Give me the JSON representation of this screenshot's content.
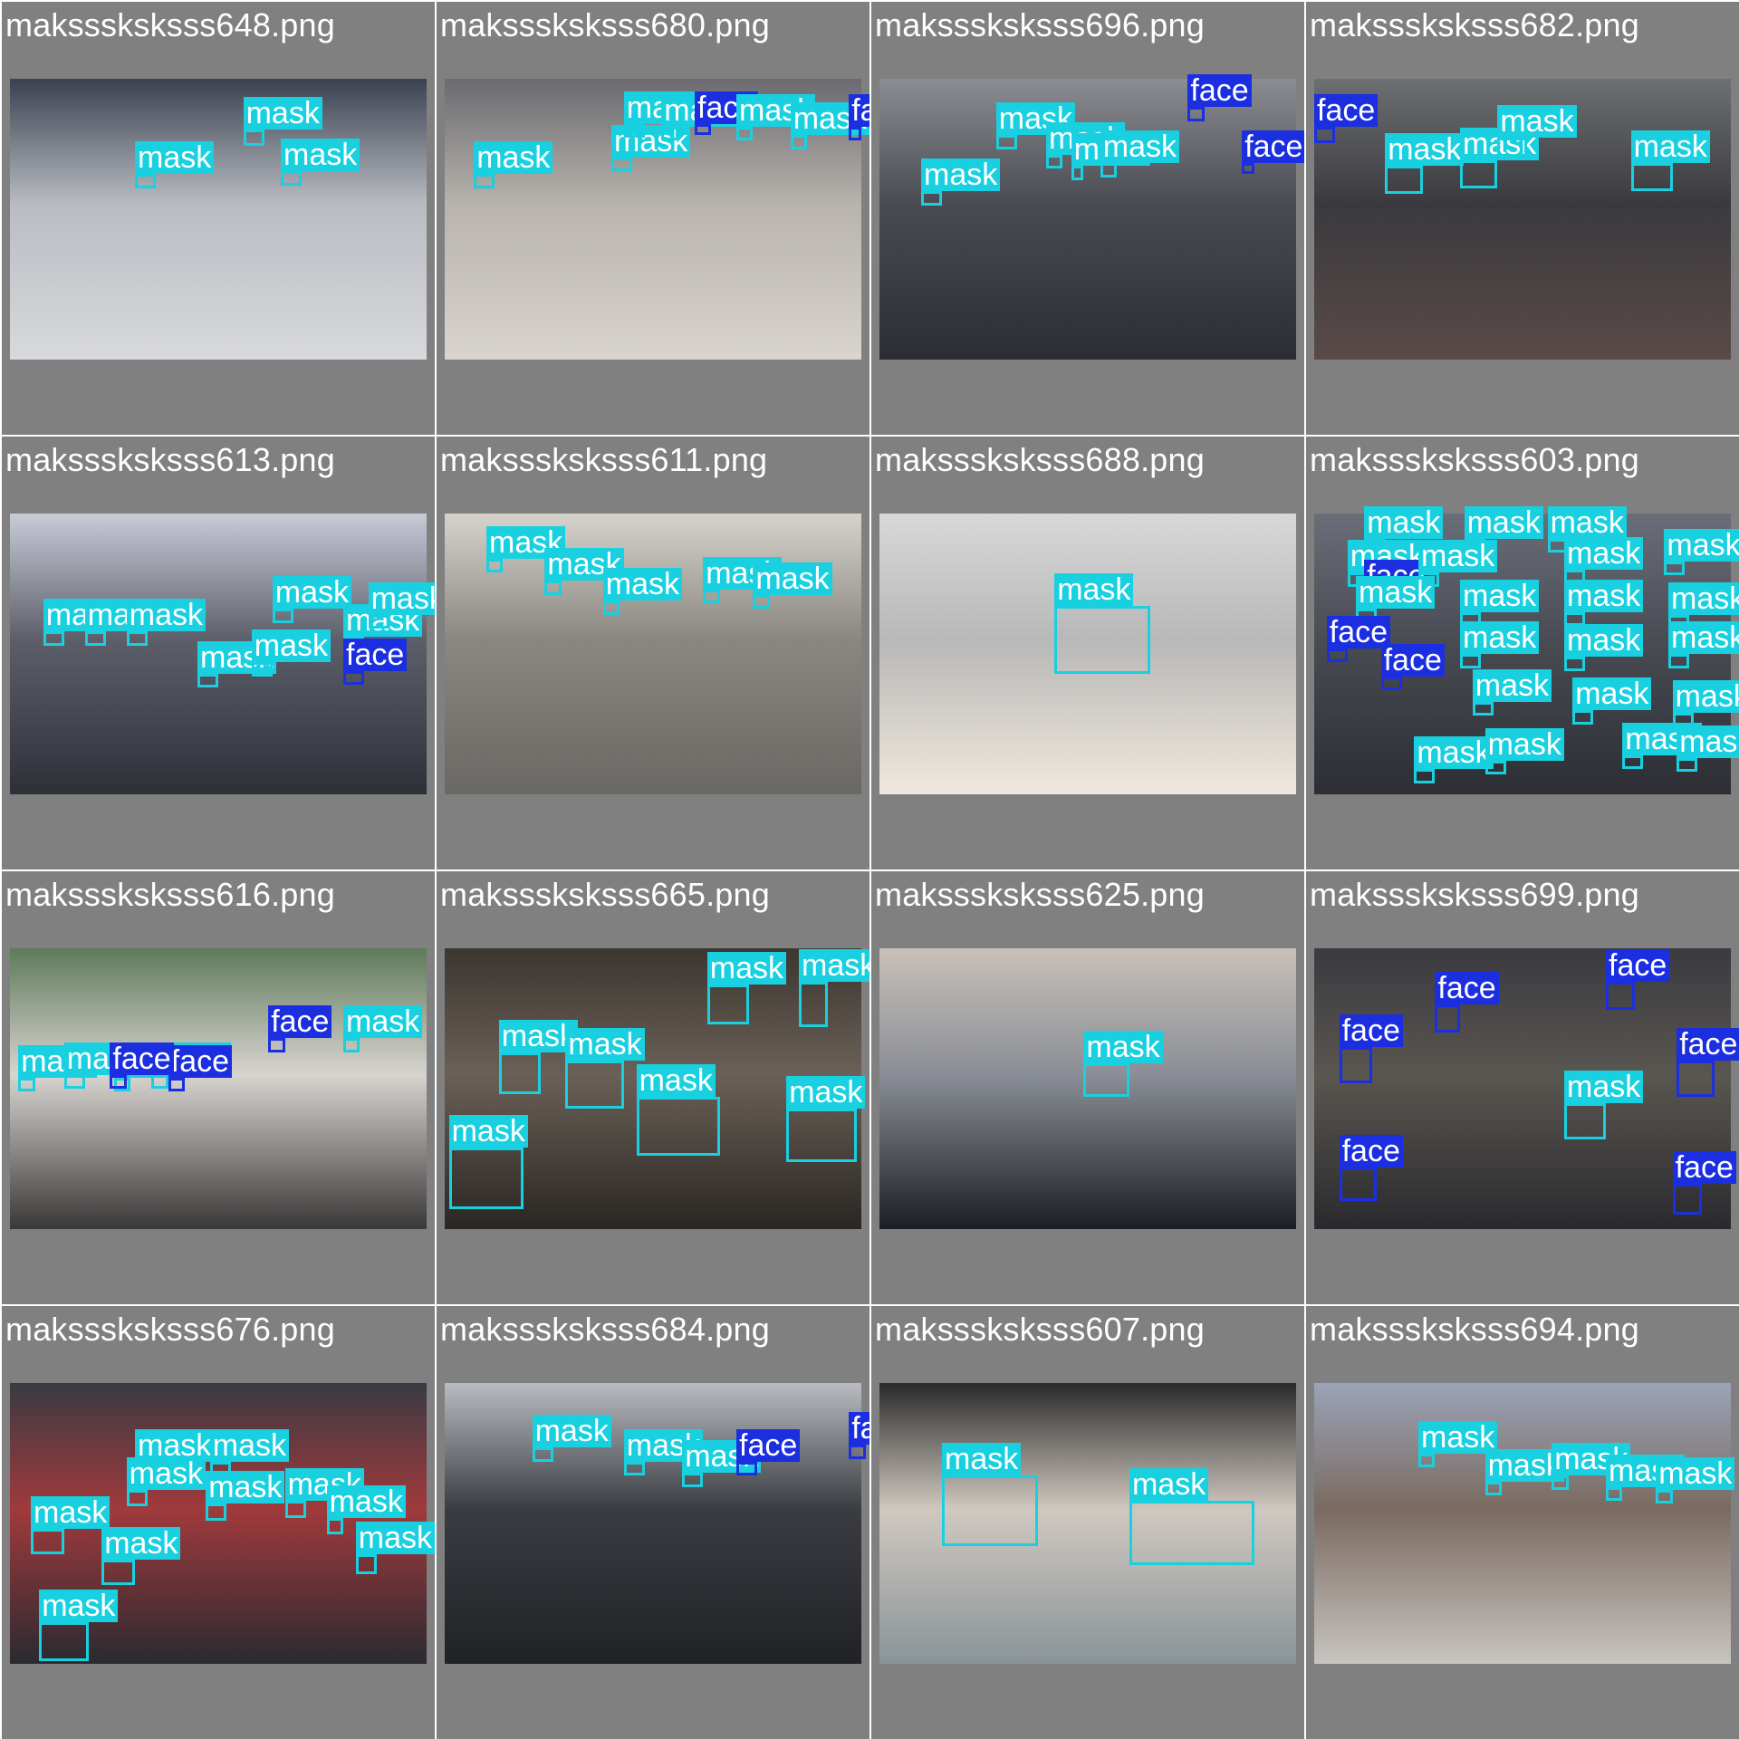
{
  "classes": {
    "mask": {
      "label": "mask",
      "color": "#19d0e0"
    },
    "face": {
      "label": "face",
      "color": "#1b2fe0"
    }
  },
  "tiles": [
    {
      "filename": "maksssksksss648.png",
      "scene": [
        "#3a4150",
        "#b9bcc2",
        "#d8d9dc"
      ],
      "detections": [
        [
          "mask",
          0.56,
          0.18,
          0.05,
          0.06
        ],
        [
          "mask",
          0.3,
          0.34,
          0.05,
          0.05
        ],
        [
          "mask",
          0.65,
          0.33,
          0.05,
          0.05
        ]
      ]
    },
    {
      "filename": "maksssksksss680.png",
      "scene": [
        "#6a6a70",
        "#b8b3ad",
        "#d9d4cf"
      ],
      "detections": [
        [
          "mask",
          0.07,
          0.34,
          0.05,
          0.05
        ],
        [
          "mask",
          0.4,
          0.28,
          0.05,
          0.05
        ],
        [
          "mask",
          0.43,
          0.16,
          0.05,
          0.05
        ],
        [
          "mask",
          0.52,
          0.17,
          0.04,
          0.05
        ],
        [
          "face",
          0.6,
          0.16,
          0.04,
          0.04
        ],
        [
          "mask",
          0.7,
          0.17,
          0.04,
          0.05
        ],
        [
          "mask",
          0.83,
          0.2,
          0.04,
          0.05
        ],
        [
          "face",
          0.97,
          0.17,
          0.03,
          0.05
        ]
      ]
    },
    {
      "filename": "maksssksksss696.png",
      "scene": [
        "#8a8d92",
        "#4a4b52",
        "#2c2d33"
      ],
      "detections": [
        [
          "mask",
          0.1,
          0.4,
          0.05,
          0.05
        ],
        [
          "mask",
          0.28,
          0.2,
          0.05,
          0.05
        ],
        [
          "mask",
          0.4,
          0.27,
          0.04,
          0.05
        ],
        [
          "mask",
          0.46,
          0.31,
          0.03,
          0.05
        ],
        [
          "mask",
          0.53,
          0.3,
          0.04,
          0.05
        ],
        [
          "face",
          0.74,
          0.1,
          0.04,
          0.05
        ],
        [
          "face",
          0.87,
          0.3,
          0.03,
          0.04
        ]
      ]
    },
    {
      "filename": "maksssksksss682.png",
      "scene": [
        "#6d6f72",
        "#3a3a3e",
        "#5a4a48"
      ],
      "detections": [
        [
          "face",
          0.0,
          0.17,
          0.05,
          0.06
        ],
        [
          "mask",
          0.17,
          0.31,
          0.09,
          0.1
        ],
        [
          "mask",
          0.35,
          0.29,
          0.09,
          0.1
        ],
        [
          "mask",
          0.76,
          0.3,
          0.1,
          0.1
        ],
        [
          "mask",
          0.44,
          0.21,
          0.07,
          0.08
        ]
      ]
    },
    {
      "filename": "maksssksksss613.png",
      "scene": [
        "#c8ccd8",
        "#5c5f6a",
        "#2e3038"
      ],
      "detections": [
        [
          "mask",
          0.08,
          0.42,
          0.05,
          0.05
        ],
        [
          "mask",
          0.18,
          0.42,
          0.05,
          0.05
        ],
        [
          "mask",
          0.28,
          0.42,
          0.05,
          0.05
        ],
        [
          "mask",
          0.45,
          0.57,
          0.05,
          0.05
        ],
        [
          "mask",
          0.58,
          0.53,
          0.05,
          0.05
        ],
        [
          "mask",
          0.63,
          0.34,
          0.05,
          0.05
        ],
        [
          "mask",
          0.8,
          0.44,
          0.05,
          0.05
        ],
        [
          "mask",
          0.86,
          0.36,
          0.05,
          0.05
        ],
        [
          "face",
          0.8,
          0.56,
          0.05,
          0.05
        ]
      ]
    },
    {
      "filename": "maksssksksss611.png",
      "scene": [
        "#d6d2cc",
        "#8a8680",
        "#6a6864"
      ],
      "detections": [
        [
          "mask",
          0.1,
          0.16,
          0.04,
          0.05
        ],
        [
          "mask",
          0.24,
          0.24,
          0.04,
          0.05
        ],
        [
          "mask",
          0.38,
          0.31,
          0.04,
          0.05
        ],
        [
          "mask",
          0.62,
          0.27,
          0.04,
          0.05
        ],
        [
          "mask",
          0.74,
          0.29,
          0.04,
          0.05
        ]
      ]
    },
    {
      "filename": "maksssksksss688.png",
      "scene": [
        "#d8d8d8",
        "#b8b8b8",
        "#f0e8dc"
      ],
      "detections": [
        [
          "mask",
          0.42,
          0.33,
          0.23,
          0.24
        ]
      ]
    },
    {
      "filename": "maksssksksss603.png",
      "scene": [
        "#6a6e78",
        "#4a4c54",
        "#2c2e34"
      ],
      "detections": [
        [
          "mask",
          0.12,
          0.09,
          0.05,
          0.05
        ],
        [
          "mask",
          0.36,
          0.09,
          0.05,
          0.05
        ],
        [
          "mask",
          0.56,
          0.09,
          0.05,
          0.05
        ],
        [
          "mask",
          0.08,
          0.21,
          0.05,
          0.05
        ],
        [
          "face",
          0.12,
          0.28,
          0.05,
          0.05
        ],
        [
          "mask",
          0.25,
          0.21,
          0.05,
          0.05
        ],
        [
          "mask",
          0.6,
          0.2,
          0.05,
          0.05
        ],
        [
          "mask",
          0.84,
          0.17,
          0.05,
          0.05
        ],
        [
          "mask",
          0.1,
          0.34,
          0.05,
          0.05
        ],
        [
          "mask",
          0.35,
          0.35,
          0.05,
          0.05
        ],
        [
          "mask",
          0.6,
          0.35,
          0.05,
          0.05
        ],
        [
          "mask",
          0.85,
          0.36,
          0.05,
          0.05
        ],
        [
          "face",
          0.03,
          0.48,
          0.05,
          0.05
        ],
        [
          "face",
          0.16,
          0.58,
          0.05,
          0.05
        ],
        [
          "mask",
          0.35,
          0.5,
          0.05,
          0.05
        ],
        [
          "mask",
          0.6,
          0.51,
          0.05,
          0.05
        ],
        [
          "mask",
          0.85,
          0.5,
          0.05,
          0.05
        ],
        [
          "mask",
          0.38,
          0.67,
          0.05,
          0.05
        ],
        [
          "mask",
          0.62,
          0.7,
          0.05,
          0.05
        ],
        [
          "mask",
          0.86,
          0.71,
          0.05,
          0.05
        ],
        [
          "mask",
          0.24,
          0.91,
          0.05,
          0.05
        ],
        [
          "mask",
          0.41,
          0.88,
          0.05,
          0.05
        ],
        [
          "mask",
          0.74,
          0.86,
          0.05,
          0.05
        ],
        [
          "mask",
          0.87,
          0.87,
          0.05,
          0.05
        ]
      ]
    },
    {
      "filename": "maksssksksss616.png",
      "scene": [
        "#5e7a5a",
        "#d8d4d0",
        "#3a3838"
      ],
      "detections": [
        [
          "mask",
          0.02,
          0.46,
          0.04,
          0.05
        ],
        [
          "mask",
          0.13,
          0.45,
          0.05,
          0.05
        ],
        [
          "mask",
          0.25,
          0.46,
          0.04,
          0.05
        ],
        [
          "mask",
          0.34,
          0.45,
          0.04,
          0.05
        ],
        [
          "face",
          0.38,
          0.46,
          0.04,
          0.05
        ],
        [
          "face",
          0.62,
          0.32,
          0.04,
          0.05
        ],
        [
          "mask",
          0.8,
          0.32,
          0.04,
          0.05
        ],
        [
          "face",
          0.24,
          0.45,
          0.04,
          0.05
        ]
      ]
    },
    {
      "filename": "maksssksksss665.png",
      "scene": [
        "#3c3630",
        "#6a6058",
        "#2a2622"
      ],
      "detections": [
        [
          "mask",
          0.63,
          0.13,
          0.1,
          0.14
        ],
        [
          "mask",
          0.85,
          0.12,
          0.07,
          0.16
        ],
        [
          "mask",
          0.13,
          0.37,
          0.1,
          0.15
        ],
        [
          "mask",
          0.29,
          0.4,
          0.14,
          0.17
        ],
        [
          "mask",
          0.46,
          0.53,
          0.2,
          0.21
        ],
        [
          "mask",
          0.82,
          0.57,
          0.17,
          0.19
        ],
        [
          "mask",
          0.01,
          0.71,
          0.18,
          0.22
        ]
      ]
    },
    {
      "filename": "maksssksksss625.png",
      "scene": [
        "#c8c0b8",
        "#8a8e96",
        "#1c1e24"
      ],
      "detections": [
        [
          "mask",
          0.49,
          0.41,
          0.11,
          0.12
        ]
      ]
    },
    {
      "filename": "maksssksksss699.png",
      "scene": [
        "#3a3a40",
        "#5a5650",
        "#2a2a2e"
      ],
      "detections": [
        [
          "face",
          0.7,
          0.12,
          0.07,
          0.1
        ],
        [
          "face",
          0.29,
          0.2,
          0.06,
          0.1
        ],
        [
          "face",
          0.06,
          0.35,
          0.08,
          0.13
        ],
        [
          "face",
          0.87,
          0.4,
          0.09,
          0.13
        ],
        [
          "mask",
          0.6,
          0.55,
          0.1,
          0.13
        ],
        [
          "face",
          0.06,
          0.78,
          0.09,
          0.12
        ],
        [
          "face",
          0.86,
          0.84,
          0.07,
          0.11
        ]
      ]
    },
    {
      "filename": "maksssksksss676.png",
      "scene": [
        "#3a3a42",
        "#a03a3c",
        "#2a2a30"
      ],
      "detections": [
        [
          "mask",
          0.3,
          0.28,
          0.05,
          0.07
        ],
        [
          "mask",
          0.48,
          0.28,
          0.05,
          0.06
        ],
        [
          "mask",
          0.28,
          0.38,
          0.05,
          0.06
        ],
        [
          "mask",
          0.47,
          0.43,
          0.05,
          0.06
        ],
        [
          "mask",
          0.66,
          0.42,
          0.05,
          0.06
        ],
        [
          "mask",
          0.76,
          0.48,
          0.04,
          0.06
        ],
        [
          "mask",
          0.05,
          0.52,
          0.08,
          0.09
        ],
        [
          "mask",
          0.22,
          0.63,
          0.08,
          0.09
        ],
        [
          "mask",
          0.83,
          0.61,
          0.05,
          0.07
        ],
        [
          "mask",
          0.07,
          0.85,
          0.12,
          0.14
        ]
      ]
    },
    {
      "filename": "maksssksksss684.png",
      "scene": [
        "#b8bcc0",
        "#3a3c42",
        "#202226"
      ],
      "detections": [
        [
          "mask",
          0.21,
          0.23,
          0.05,
          0.05
        ],
        [
          "mask",
          0.43,
          0.28,
          0.05,
          0.05
        ],
        [
          "mask",
          0.57,
          0.32,
          0.05,
          0.05
        ],
        [
          "face",
          0.7,
          0.28,
          0.05,
          0.05
        ],
        [
          "face",
          0.97,
          0.22,
          0.04,
          0.05
        ]
      ]
    },
    {
      "filename": "maksssksksss607.png",
      "scene": [
        "#2a2a2a",
        "#d0c8c0",
        "#8a9498"
      ],
      "detections": [
        [
          "mask",
          0.15,
          0.33,
          0.23,
          0.25
        ],
        [
          "mask",
          0.6,
          0.42,
          0.3,
          0.23
        ]
      ]
    },
    {
      "filename": "maksssksksss694.png",
      "scene": [
        "#9aa4b8",
        "#7a6a60",
        "#c8c4c0"
      ],
      "detections": [
        [
          "mask",
          0.25,
          0.25,
          0.04,
          0.05
        ],
        [
          "mask",
          0.41,
          0.35,
          0.04,
          0.05
        ],
        [
          "mask",
          0.57,
          0.33,
          0.04,
          0.05
        ],
        [
          "mask",
          0.7,
          0.37,
          0.04,
          0.05
        ],
        [
          "mask",
          0.82,
          0.38,
          0.04,
          0.05
        ]
      ]
    }
  ]
}
